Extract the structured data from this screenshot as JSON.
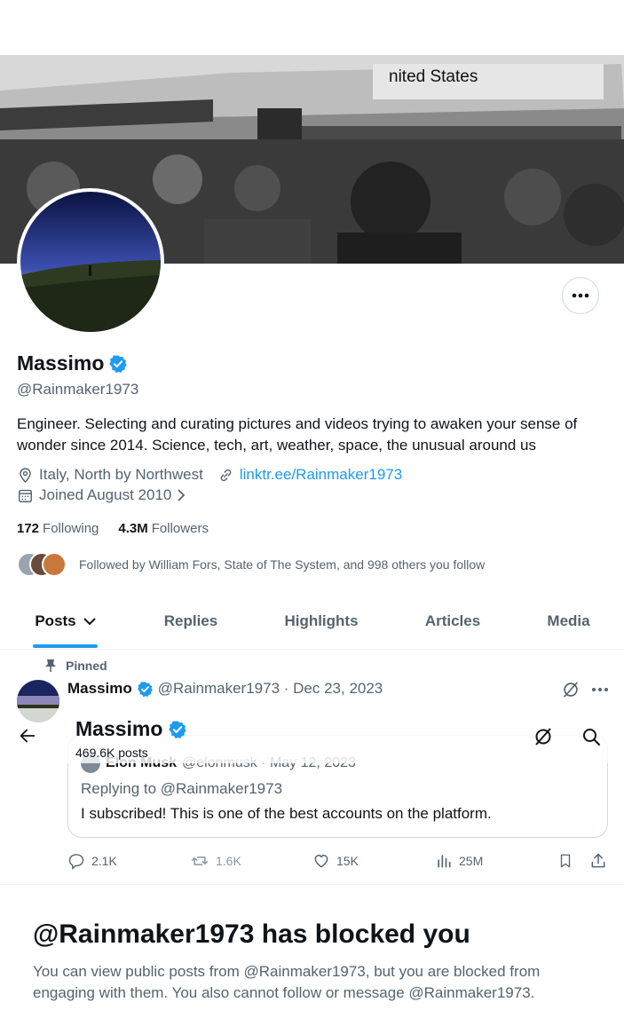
{
  "profile": {
    "name": "Massimo",
    "handle": "@Rainmaker1973",
    "bio": "Engineer. Selecting and curating pictures and videos trying to awaken your sense of wonder since 2014. Science, tech, art, weather, space, the unusual around us",
    "location": "Italy, North by Northwest",
    "website": "linktr.ee/Rainmaker1973",
    "joined": "Joined August 2010",
    "following_count": "172",
    "following_label": "Following",
    "followers_count": "4.3M",
    "followers_label": "Followers",
    "followed_by": "Followed by William Fors, State of The System, and 998 others you follow",
    "banner_text": "nited States"
  },
  "tabs": [
    {
      "label": "Posts"
    },
    {
      "label": "Replies"
    },
    {
      "label": "Highlights"
    },
    {
      "label": "Articles"
    },
    {
      "label": "Media"
    }
  ],
  "sticky_header": {
    "name": "Massimo",
    "posts_count": "469.6K posts"
  },
  "pinned_post": {
    "pinned_label": "Pinned",
    "author": "Massimo",
    "meta": "@Rainmaker1973 · Dec 23, 2023",
    "quote": {
      "author": "Elon Musk",
      "handle_date": "@elonmusk · May 12, 2023",
      "replying_to": "Replying to @Rainmaker1973",
      "text": "I subscribed! This is one of the best accounts on the platform."
    },
    "replies": "2.1K",
    "reposts": "1.6K",
    "likes": "15K",
    "views": "25M"
  },
  "blocked": {
    "title": "@Rainmaker1973 has blocked you",
    "description": "You can view public posts from @Rainmaker1973, but you are blocked from engaging with them. You also cannot follow or message @Rainmaker1973."
  },
  "colors": {
    "accent": "#1d9bf0",
    "text": "#0f1419",
    "secondary": "#536471"
  }
}
